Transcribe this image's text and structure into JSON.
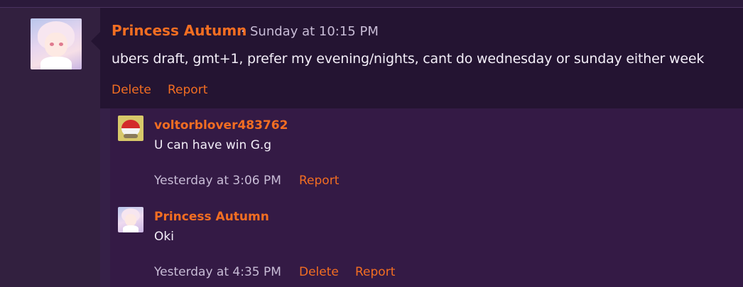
{
  "post": {
    "author": "Princess Autumn",
    "separator": "·",
    "timestamp": "Sunday at 10:15 PM",
    "message": "ubers draft, gmt+1, prefer my evening/nights, cant do wednesday or sunday either week",
    "actions": {
      "delete": "Delete",
      "report": "Report"
    }
  },
  "replies": [
    {
      "author": "voltorblover483762",
      "avatar_icon": "voltorb-avatar",
      "message": "U can have win G.g",
      "timestamp": "Yesterday at 3:06 PM",
      "actions": {
        "report": "Report"
      }
    },
    {
      "author": "Princess Autumn",
      "avatar_icon": "anime-girl-avatar",
      "message": "Oki",
      "timestamp": "Yesterday at 4:35 PM",
      "actions": {
        "delete": "Delete",
        "report": "Report"
      }
    }
  ],
  "colors": {
    "accent": "#f36e22",
    "background": "#352047",
    "post_background": "#241432",
    "reply_background": "#341a45",
    "text": "#f3eef8",
    "muted_text": "#c8bcd6"
  }
}
